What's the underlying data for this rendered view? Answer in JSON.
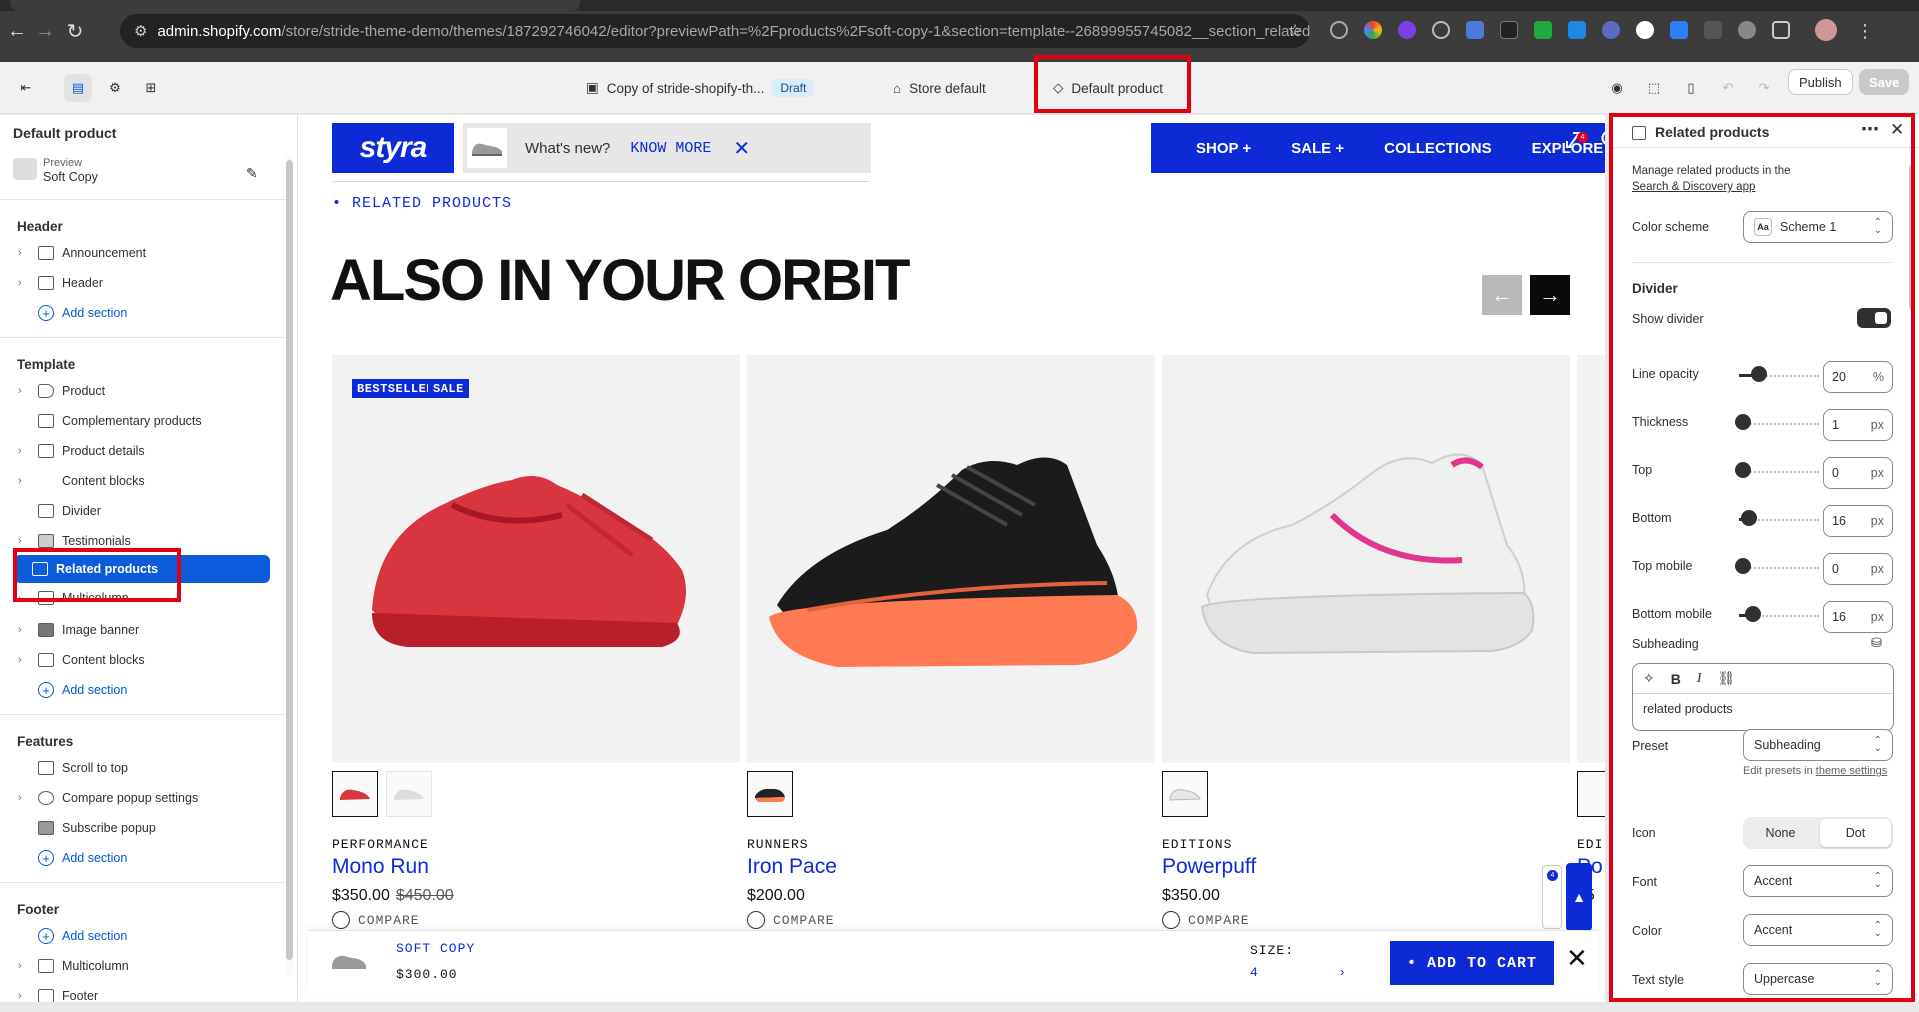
{
  "browser": {
    "url_host": "admin.shopify.com",
    "url_path": "/store/stride-theme-demo/themes/187292746042/editor?previewPath=%2Fproducts%2Fsoft-copy-1&section=template--26899955745082__section_related_pr..."
  },
  "topbar": {
    "theme_name": "Copy of stride-shopify-th...",
    "theme_status": "Draft",
    "store": "Store default",
    "template": "Default product",
    "publish": "Publish",
    "save": "Save"
  },
  "left": {
    "title": "Default product",
    "preview_label": "Preview",
    "preview_value": "Soft Copy",
    "header_group": "Header",
    "header_items": [
      "Announcement",
      "Header"
    ],
    "add_section": "Add section",
    "template_group": "Template",
    "template_items": [
      "Product",
      "Complementary products",
      "Product details",
      "Content blocks",
      "Divider",
      "Testimonials",
      "Related products",
      "Multicolumn",
      "Image banner",
      "Content blocks"
    ],
    "features_group": "Features",
    "features_items": [
      "Scroll to top",
      "Compare popup settings",
      "Subscribe popup"
    ],
    "footer_group": "Footer",
    "footer_items": [
      "Multicolumn",
      "Footer"
    ]
  },
  "preview": {
    "logo": "styra",
    "news_text": "What's new?",
    "news_link": "KNOW MORE",
    "nav": [
      "SHOP +",
      "SALE +",
      "COLLECTIONS",
      "EXPLORE +"
    ],
    "compare_count": "4",
    "cart_count": "1",
    "crumb": "• RELATED PRODUCTS",
    "heading": "ALSO IN YOUR ORBIT",
    "products": [
      {
        "category": "PERFORMANCE",
        "name": "Mono Run",
        "price": "$350.00",
        "old_price": "$450.00",
        "badges": [
          "BESTSELLER",
          "SALE"
        ],
        "compare": "COMPARE"
      },
      {
        "category": "RUNNERS",
        "name": "Iron Pace",
        "price": "$200.00",
        "old_price": "",
        "badges": [],
        "compare": "COMPARE"
      },
      {
        "category": "EDITIONS",
        "name": "Powerpuff",
        "price": "$350.00",
        "old_price": "",
        "badges": [],
        "compare": "COMPARE"
      },
      {
        "category": "EDI",
        "name": "Po",
        "price": "$5",
        "old_price": "",
        "badges": [],
        "compare": ""
      }
    ],
    "sticky": {
      "name": "SOFT COPY",
      "price": "$300.00",
      "size_label": "SIZE:",
      "size_value": "4",
      "button": "• ADD TO CART"
    },
    "float_badge": "4"
  },
  "right": {
    "title": "Related products",
    "desc": "Manage related products in the",
    "desc_link": "Search & Discovery app",
    "color_scheme_label": "Color scheme",
    "color_scheme_value": "Scheme 1",
    "color_scheme_icon": "Aa",
    "divider_heading": "Divider",
    "show_divider": "Show divider",
    "show_divider_on": true,
    "sliders": [
      {
        "label": "Line opacity",
        "value": "20",
        "unit": "%",
        "level": 0.2
      },
      {
        "label": "Thickness",
        "value": "1",
        "unit": "px",
        "level": 0.0
      },
      {
        "label": "Top",
        "value": "0",
        "unit": "px",
        "level": 0.0
      },
      {
        "label": "Bottom",
        "value": "16",
        "unit": "px",
        "level": 0.08
      },
      {
        "label": "Top mobile",
        "value": "0",
        "unit": "px",
        "level": 0.0
      },
      {
        "label": "Bottom mobile",
        "value": "16",
        "unit": "px",
        "level": 0.12
      }
    ],
    "subheading_label": "Subheading",
    "subheading_value": "related products",
    "preset_label": "Preset",
    "preset_value": "Subheading",
    "preset_hint": "Edit presets in",
    "preset_hint_link": "theme settings",
    "icon_label": "Icon",
    "icon_options": [
      "None",
      "Dot"
    ],
    "icon_selected": "Dot",
    "font_label": "Font",
    "font_value": "Accent",
    "color_label": "Color",
    "color_value": "Accent",
    "text_style_label": "Text style",
    "text_style_value": "Uppercase"
  },
  "colors": {
    "brand_blue": "#0c2bd6",
    "selection_blue": "#0c5bdb",
    "highlight_red": "#e00012"
  }
}
